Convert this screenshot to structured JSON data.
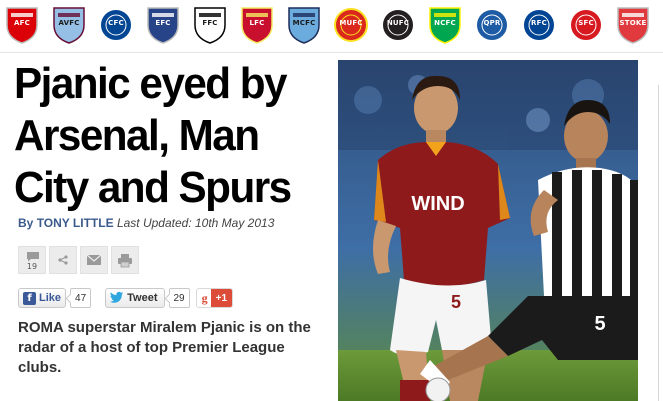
{
  "clubs": [
    {
      "name": "Arsenal",
      "abbr": "AFC",
      "color": "#db0007",
      "accent": "#ffffff",
      "shape": "shield"
    },
    {
      "name": "Aston Villa",
      "abbr": "AVFC",
      "color": "#95bfe5",
      "accent": "#670e36",
      "shape": "shield"
    },
    {
      "name": "Chelsea",
      "abbr": "CFC",
      "color": "#034694",
      "accent": "#ffffff",
      "shape": "circle"
    },
    {
      "name": "Everton",
      "abbr": "EFC",
      "color": "#274488",
      "accent": "#ffffff",
      "shape": "shield"
    },
    {
      "name": "Fulham",
      "abbr": "FFC",
      "color": "#ffffff",
      "accent": "#000000",
      "shape": "shield"
    },
    {
      "name": "Liverpool",
      "abbr": "LFC",
      "color": "#c8102e",
      "accent": "#f6eb61",
      "shape": "shield"
    },
    {
      "name": "Manchester City",
      "abbr": "MCFC",
      "color": "#6cabdd",
      "accent": "#1c2c5b",
      "shape": "shield"
    },
    {
      "name": "Manchester United",
      "abbr": "MUFC",
      "color": "#da291c",
      "accent": "#fbe122",
      "shape": "circle"
    },
    {
      "name": "Newcastle United",
      "abbr": "NUFC",
      "color": "#241f20",
      "accent": "#ffffff",
      "shape": "circle"
    },
    {
      "name": "Norwich City",
      "abbr": "NCFC",
      "color": "#00a650",
      "accent": "#fff200",
      "shape": "shield"
    },
    {
      "name": "QPR",
      "abbr": "QPR",
      "color": "#1d5ba4",
      "accent": "#ffffff",
      "shape": "circle"
    },
    {
      "name": "Reading",
      "abbr": "RFC",
      "color": "#004494",
      "accent": "#ffffff",
      "shape": "circle"
    },
    {
      "name": "Southampton",
      "abbr": "SFC",
      "color": "#d71920",
      "accent": "#ffffff",
      "shape": "circle"
    },
    {
      "name": "Stoke City",
      "abbr": "STOKE",
      "color": "#e03a3e",
      "accent": "#ffffff",
      "shape": "shield"
    }
  ],
  "article": {
    "headline": "Pjanic eyed by Arsenal, Man City and Spurs",
    "byline_prefix": "By",
    "author": "TONY LITTLE",
    "updated": "Last Updated: 10th May 2013",
    "standfirst": "ROMA superstar Miralem Pjanic is on the radar of a host of top Premier League clubs.",
    "photo": {
      "left_shirt_text": "WIND",
      "left_number": "5",
      "right_number": "5"
    }
  },
  "tools": {
    "comments_icon": "comment-icon",
    "comments_count": "19",
    "share_icon": "share-icon",
    "email_icon": "email-icon",
    "print_icon": "print-icon"
  },
  "social": {
    "facebook_label": "Like",
    "facebook_count": "47",
    "twitter_label": "Tweet",
    "twitter_count": "29",
    "gplus_letter": "g",
    "gplus_label": "+1"
  }
}
